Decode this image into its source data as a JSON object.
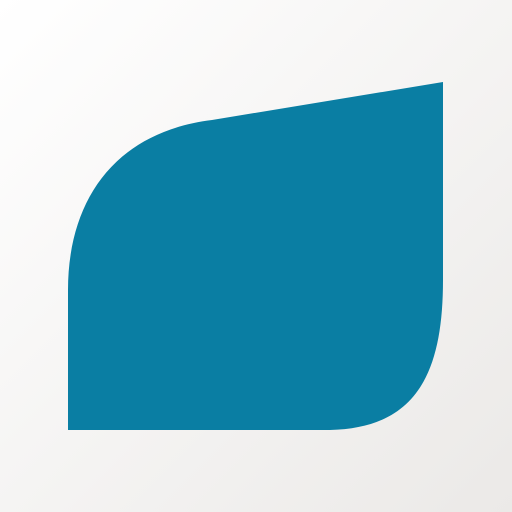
{
  "app_icon": {
    "icon_name": "leaf-icon",
    "colors": {
      "background_light": "#ffffff",
      "background_dark": "#ebe9e7",
      "leaf_fill": "#0a7ea3"
    }
  }
}
